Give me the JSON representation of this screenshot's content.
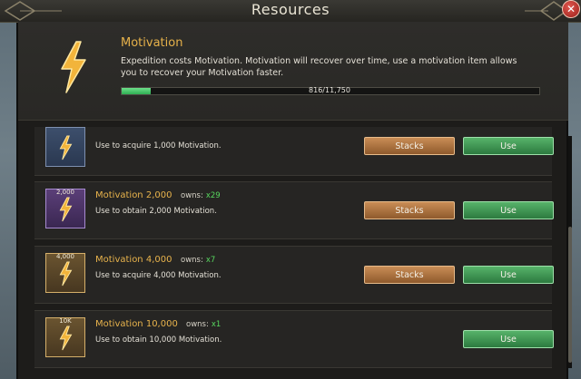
{
  "window": {
    "title": "Resources"
  },
  "header": {
    "title": "Motivation",
    "description": "Expedition costs Motivation. Motivation will recover over time, use a motivation item allows you to recover your Motivation faster.",
    "progress_text": "816/11,750",
    "progress_fraction": 0.069
  },
  "items": [
    {
      "name": "",
      "owns_label": "",
      "owns_count": "",
      "description": "Use to acquire 1,000 Motivation.",
      "thumb_label": "",
      "stacks_label": "Stacks",
      "use_label": "Use"
    },
    {
      "name": "Motivation 2,000",
      "owns_label": "owns:",
      "owns_count": "x29",
      "description": "Use to obtain 2,000 Motivation.",
      "thumb_label": "2,000",
      "stacks_label": "Stacks",
      "use_label": "Use"
    },
    {
      "name": "Motivation 4,000",
      "owns_label": "owns:",
      "owns_count": "x7",
      "description": "Use to acquire 4,000 Motivation.",
      "thumb_label": "4,000",
      "stacks_label": "Stacks",
      "use_label": "Use"
    },
    {
      "name": "Motivation 10,000",
      "owns_label": "owns:",
      "owns_count": "x1",
      "description": "Use to obtain 10,000 Motivation.",
      "thumb_label": "10K",
      "use_label": "Use"
    }
  ],
  "icons": {
    "motivation": "lightning-bolt-icon",
    "close": "close-icon"
  },
  "colors": {
    "accent_gold": "#e8b34c",
    "owns_green": "#57d65e",
    "use_button": "#3f9a53",
    "stacks_button": "#b07840"
  }
}
